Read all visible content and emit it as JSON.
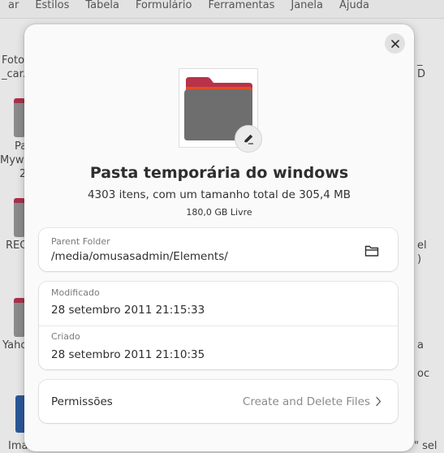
{
  "menubar": {
    "items": [
      "ar",
      "Estilos",
      "Tabela",
      "Formulário",
      "Ferramentas",
      "Janela",
      "Ajuda"
    ]
  },
  "background_labels": {
    "left_1": "Foto",
    "left_2": "_car.",
    "left_3": "Pa",
    "left_4": "Myw",
    "left_5": "2",
    "left_6": "REC",
    "left_7": "Yaho",
    "left_8": "Ima",
    "right_1": "_",
    "right_2": "D",
    "right_3": "el",
    "right_4": ")",
    "right_5": "a",
    "right_6": "oc",
    "bottom_right": "\" sel"
  },
  "dialog": {
    "title": "Pasta temporária do windows",
    "subtitle": "4303 itens, com um tamanho total de 305,4 MB",
    "free_space": "180,0 GB Livre",
    "parent_folder": {
      "label": "Parent Folder",
      "value": "/media/omusasadmin/Elements/"
    },
    "modified": {
      "label": "Modificado",
      "value": "28 setembro 2011 21:15:33"
    },
    "created": {
      "label": "Criado",
      "value": "28 setembro 2011 21:10:35"
    },
    "permissions": {
      "label": "Permissões",
      "value": "Create and Delete Files"
    }
  },
  "icons": {
    "close": "close-icon",
    "edit": "pencil-icon",
    "folder_thumb": "folder-icon",
    "open_folder": "folder-open-icon",
    "chevron": "chevron-right-icon"
  },
  "colors": {
    "folder_top": "#c0392b",
    "folder_accent": "#e95420",
    "folder_body": "#6e6e6e",
    "dialog_bg": "#fafafa"
  }
}
